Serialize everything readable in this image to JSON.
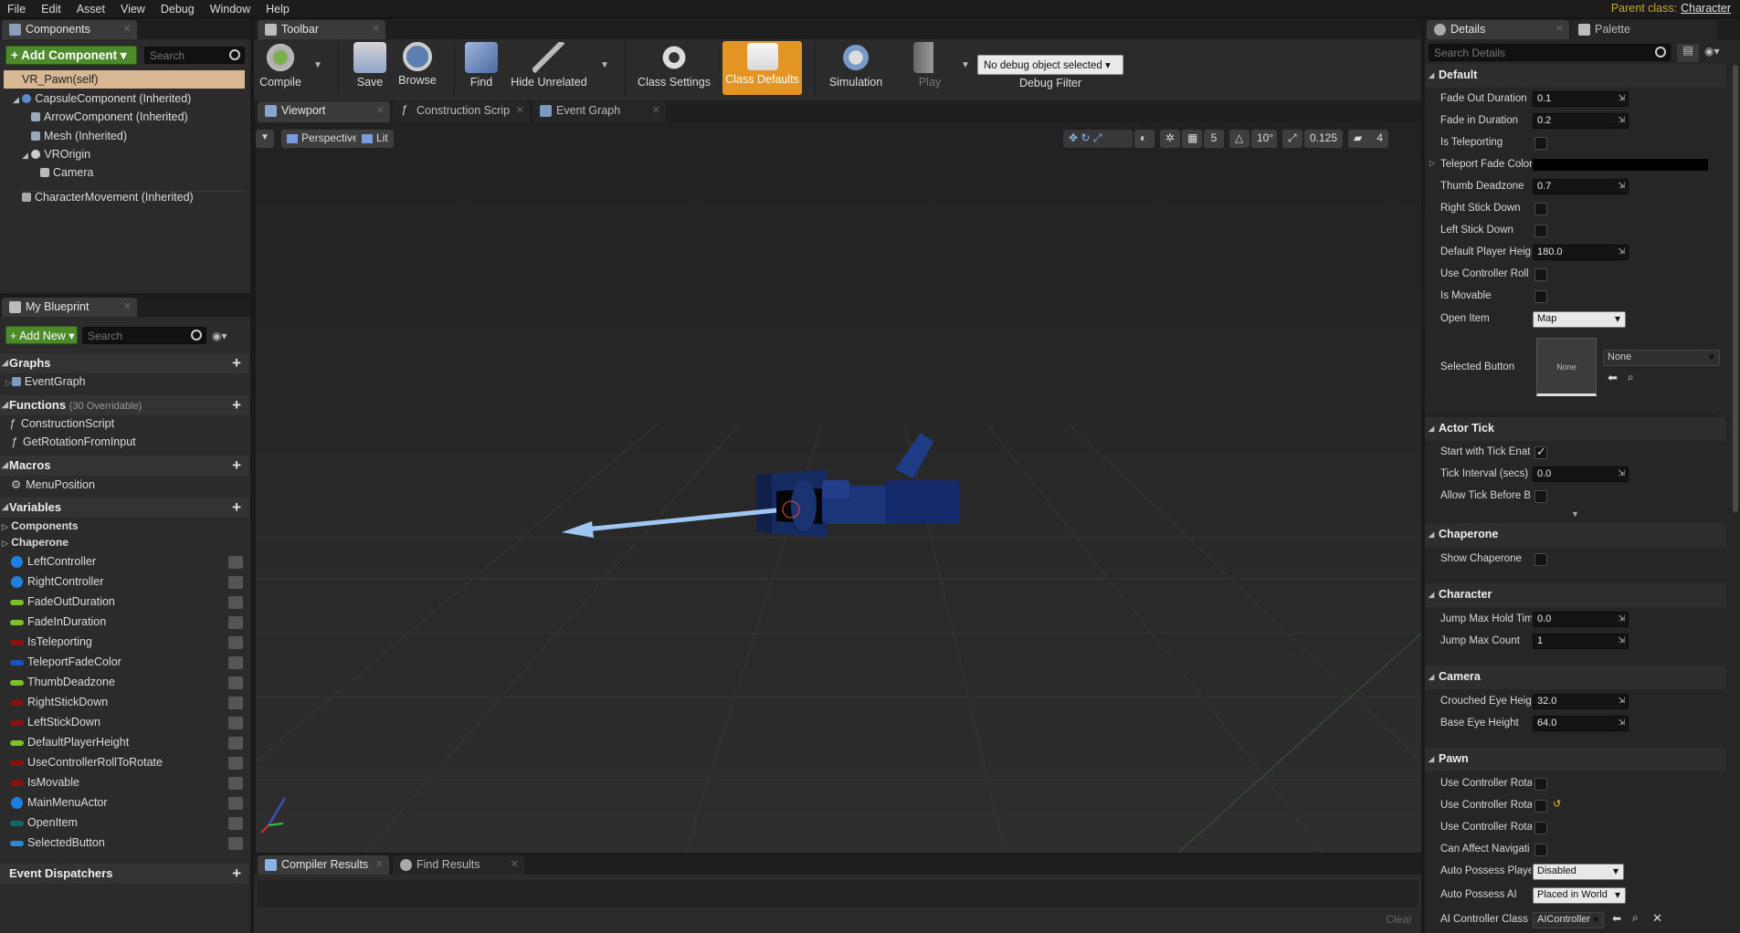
{
  "menu": [
    "File",
    "Edit",
    "Asset",
    "View",
    "Debug",
    "Window",
    "Help"
  ],
  "parent_class": {
    "label": "Parent class:",
    "value": "Character"
  },
  "components_tab": "Components",
  "add_component": "+ Add Component ▾",
  "search_placeholder": "Search",
  "components": {
    "self": "VR_Pawn(self)",
    "tree": [
      "CapsuleComponent (Inherited)",
      "ArrowComponent (Inherited)",
      "Mesh (Inherited)",
      "VROrigin",
      "Camera",
      "CharacterMovement (Inherited)"
    ]
  },
  "my_blueprint_tab": "My Blueprint",
  "add_new": "+ Add New ▾",
  "sections": {
    "graphs": "Graphs",
    "event_graph": "EventGraph",
    "functions": "Functions",
    "functions_note": "(30 Overridable)",
    "construction_script": "ConstructionScript",
    "get_rotation": "GetRotationFromInput",
    "macros": "Macros",
    "menu_position": "MenuPosition",
    "variables": "Variables",
    "components_cat": "Components",
    "chaperone_cat": "Chaperone",
    "event_dispatchers": "Event Dispatchers"
  },
  "variables": [
    {
      "name": "LeftController",
      "color": "#1e7fe0",
      "dot": true
    },
    {
      "name": "RightController",
      "color": "#1e7fe0",
      "dot": true
    },
    {
      "name": "FadeOutDuration",
      "color": "#7ec02a",
      "dot": false
    },
    {
      "name": "FadeInDuration",
      "color": "#7ec02a",
      "dot": false
    },
    {
      "name": "IsTeleporting",
      "color": "#8c1010",
      "dot": false
    },
    {
      "name": "TeleportFadeColor",
      "color": "#1a52c0",
      "dot": false
    },
    {
      "name": "ThumbDeadzone",
      "color": "#7ec02a",
      "dot": false
    },
    {
      "name": "RightStickDown",
      "color": "#8c1010",
      "dot": false
    },
    {
      "name": "LeftStickDown",
      "color": "#8c1010",
      "dot": false
    },
    {
      "name": "DefaultPlayerHeight",
      "color": "#7ec02a",
      "dot": false
    },
    {
      "name": "UseControllerRollToRotate",
      "color": "#8c1010",
      "dot": false
    },
    {
      "name": "IsMovable",
      "color": "#8c1010",
      "dot": false
    },
    {
      "name": "MainMenuActor",
      "color": "#1e7fe0",
      "dot": true
    },
    {
      "name": "OpenItem",
      "color": "#0e6a6a",
      "dot": false
    },
    {
      "name": "SelectedButton",
      "color": "#2a8ad0",
      "dot": false
    }
  ],
  "toolbar_tab": "Toolbar",
  "toolbar": {
    "compile": "Compile",
    "save": "Save",
    "browse": "Browse",
    "find": "Find",
    "hide_unrelated": "Hide Unrelated",
    "class_settings": "Class Settings",
    "class_defaults": "Class Defaults",
    "simulation": "Simulation",
    "play": "Play",
    "debug_select": "No debug object selected ▾",
    "debug_filter": "Debug Filter"
  },
  "editor_tabs": [
    "Viewport",
    "Construction Scrip",
    "Event Graph"
  ],
  "viewport": {
    "perspective": "Perspective",
    "lit": "Lit",
    "grid_snap": "5",
    "rot_snap": "10°",
    "scale_snap": "0.125",
    "cam_speed": "4"
  },
  "bottom_tabs": [
    "Compiler Results",
    "Find Results"
  ],
  "clear": "Clear",
  "details_tab": "Details",
  "palette_tab": "Palette",
  "search_details": "Search Details",
  "details": {
    "default": "Default",
    "fade_out": {
      "label": "Fade Out Duration",
      "value": "0.1"
    },
    "fade_in": {
      "label": "Fade in Duration",
      "value": "0.2"
    },
    "is_teleporting": "Is Teleporting",
    "teleport_fade_color": "Teleport Fade Color",
    "thumb_deadzone": {
      "label": "Thumb Deadzone",
      "value": "0.7"
    },
    "right_stick": "Right Stick Down",
    "left_stick": "Left Stick Down",
    "default_height": {
      "label": "Default Player Heigl",
      "value": "180.0"
    },
    "use_roll": "Use Controller Roll t",
    "is_movable": "Is Movable",
    "open_item": {
      "label": "Open Item",
      "value": "Map"
    },
    "selected_button": {
      "label": "Selected Button",
      "thumb": "None",
      "value": "None"
    },
    "actor_tick": "Actor Tick",
    "start_tick": "Start with Tick Enat",
    "tick_interval": {
      "label": "Tick Interval (secs)",
      "value": "0.0"
    },
    "allow_tick": "Allow Tick Before B",
    "chaperone": "Chaperone",
    "show_chaperone": "Show Chaperone",
    "character": "Character",
    "jump_hold": {
      "label": "Jump Max Hold Tim",
      "value": "0.0"
    },
    "jump_count": {
      "label": "Jump Max Count",
      "value": "1"
    },
    "camera": "Camera",
    "crouched_eye": {
      "label": "Crouched Eye Heigh",
      "value": "32.0"
    },
    "base_eye": {
      "label": "Base Eye Height",
      "value": "64.0"
    },
    "pawn": "Pawn",
    "use_rot1": "Use Controller Rotat",
    "use_rot2": "Use Controller Rotat",
    "use_rot3": "Use Controller Rotat",
    "can_affect": "Can Affect Navigati",
    "auto_possess_player": {
      "label": "Auto Possess Playe",
      "value": "Disabled"
    },
    "auto_possess_ai": {
      "label": "Auto Possess AI",
      "value": "Placed in World"
    },
    "ai_controller": {
      "label": "AI Controller Class",
      "value": "AIController"
    }
  }
}
